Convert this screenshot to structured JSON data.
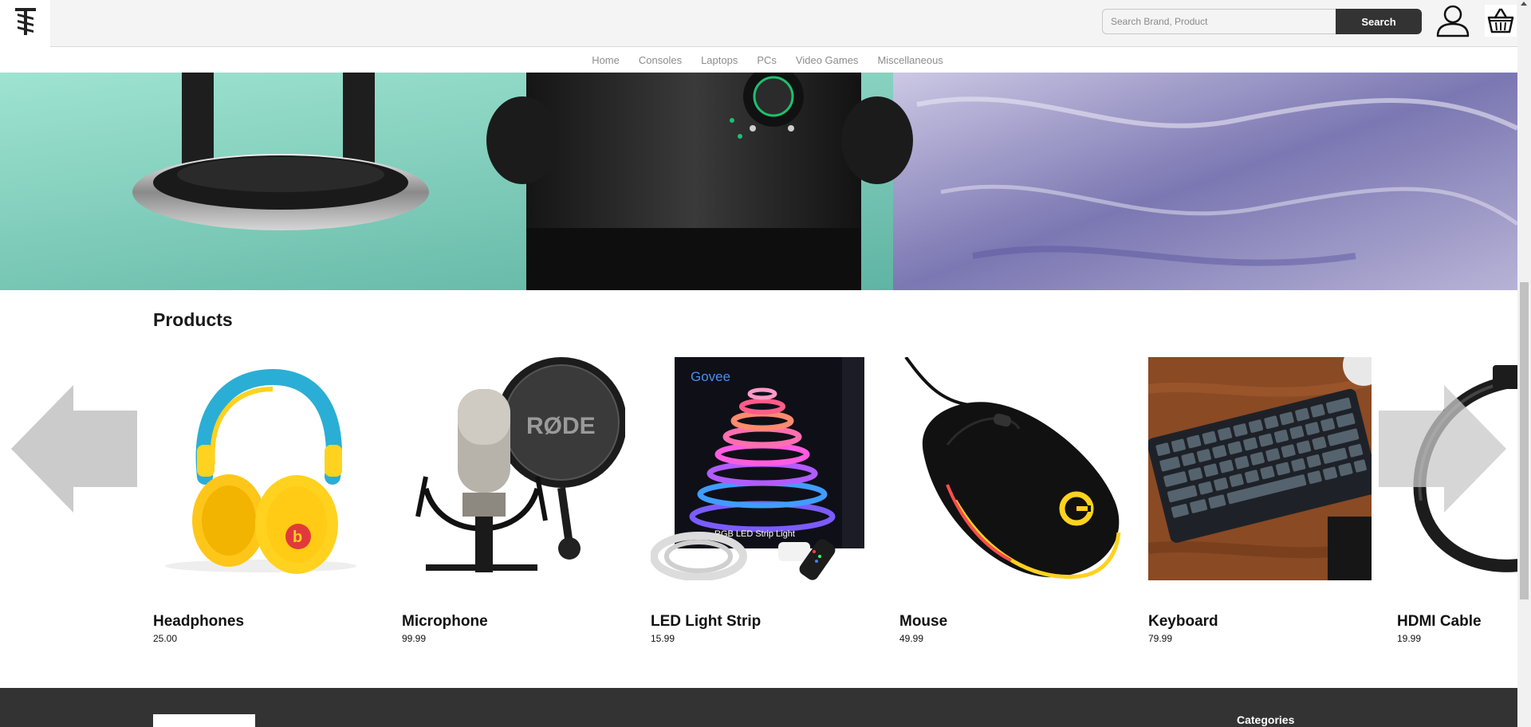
{
  "header": {
    "logo_alt": "store-logo",
    "search_placeholder": "Search Brand, Product",
    "search_button_label": "Search"
  },
  "nav": {
    "items": [
      "Home",
      "Consoles",
      "Laptops",
      "PCs",
      "Video Games",
      "Miscellaneous"
    ]
  },
  "products": {
    "title": "Products",
    "items": [
      {
        "name": "Headphones",
        "price": "25.00",
        "icon": "headphones"
      },
      {
        "name": "Microphone",
        "price": "99.99",
        "icon": "microphone"
      },
      {
        "name": "LED Light Strip",
        "price": "15.99",
        "icon": "led-strip"
      },
      {
        "name": "Mouse",
        "price": "49.99",
        "icon": "mouse"
      },
      {
        "name": "Keyboard",
        "price": "79.99",
        "icon": "keyboard"
      },
      {
        "name": "HDMI Cable",
        "price": "19.99",
        "icon": "hdmi-cable"
      }
    ]
  },
  "led_box": {
    "brand": "Govee",
    "caption": "RGB LED Strip Light"
  },
  "mic_brand": "RØDE",
  "footer": {
    "heading": "Categories"
  },
  "colors": {
    "header_bg": "#f4f4f4",
    "search_button_bg": "#333333",
    "footer_bg": "#333333",
    "nav_text": "#8c8c8c",
    "arrow": "#c8c8c8"
  }
}
